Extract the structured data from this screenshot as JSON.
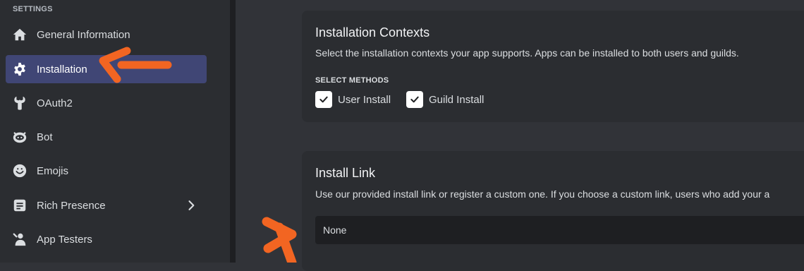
{
  "sidebar": {
    "section_label": "SETTINGS",
    "items": [
      {
        "label": "General Information",
        "icon": "home-icon"
      },
      {
        "label": "Installation",
        "icon": "gear-icon",
        "active": true
      },
      {
        "label": "OAuth2",
        "icon": "wrench-icon"
      },
      {
        "label": "Bot",
        "icon": "bot-icon"
      },
      {
        "label": "Emojis",
        "icon": "smiley-icon"
      },
      {
        "label": "Rich Presence",
        "icon": "rich-presence-icon",
        "has_submenu": true
      },
      {
        "label": "App Testers",
        "icon": "app-testers-icon"
      }
    ]
  },
  "installation_contexts": {
    "title": "Installation Contexts",
    "description": "Select the installation contexts your app supports. Apps can be installed to both users and guilds.",
    "select_methods_label": "SELECT METHODS",
    "options": [
      {
        "label": "User Install",
        "checked": true
      },
      {
        "label": "Guild Install",
        "checked": true
      }
    ]
  },
  "install_link": {
    "title": "Install Link",
    "description": "Use our provided install link or register a custom one. If you choose a custom link, users who add your a",
    "selected_value": "None"
  },
  "colors": {
    "accent": "#404675",
    "annotation_arrow": "#f26522",
    "background": "#313338",
    "sidebar": "#2b2d31"
  }
}
